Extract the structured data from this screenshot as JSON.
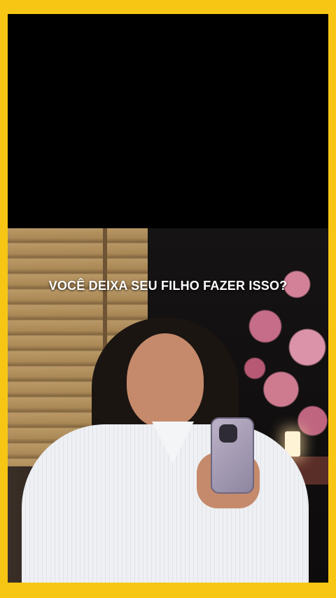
{
  "video": {
    "caption": "VOCÊ DEIXA SEU FILHO FAZER ISSO?"
  },
  "colors": {
    "border": "#F7C614",
    "caption_text": "#FFFFFF"
  }
}
